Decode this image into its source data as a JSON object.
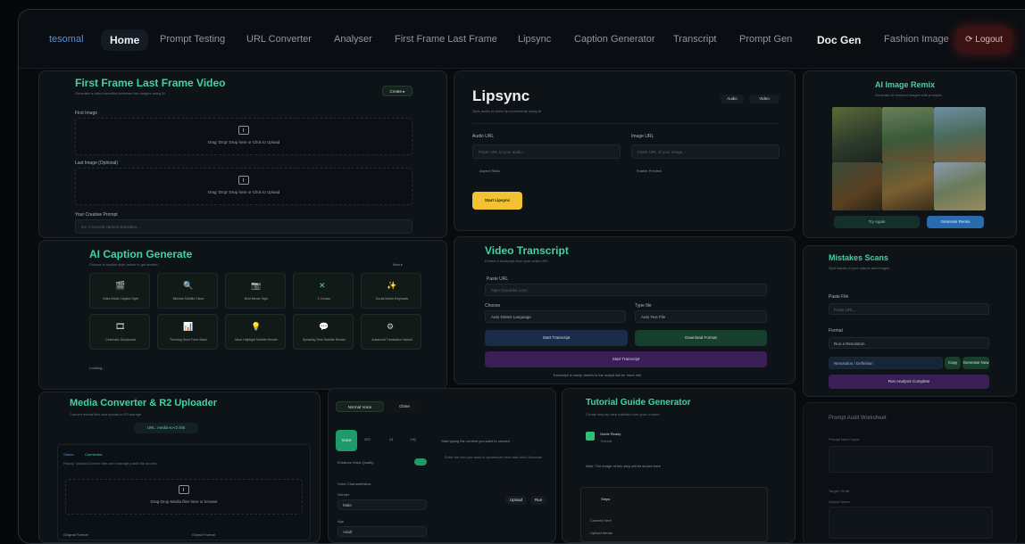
{
  "nav": {
    "brand": "tesomal",
    "items": [
      "Home",
      "Prompt Testing",
      "URL Converter",
      "Analyser",
      "First Frame Last Frame",
      "Lipsync",
      "Caption Generator",
      "Transcript",
      "Prompt Gen",
      "Doc Gen",
      "Fashion Image"
    ],
    "logout": "⟳ Logout"
  },
  "flf": {
    "title": "First Frame Last Frame Video",
    "desc": "Generate a video transition between two images using AI",
    "button": "Create ▸",
    "first_label": "First Image",
    "drop_text": "Drag 'Drop' Drop here or Click to Upload",
    "last_label": "Last Image (Optional)",
    "prompt_label": "Your Creative Prompt",
    "prompt_placeholder": "Ex: A smooth camera transition..."
  },
  "lipsync": {
    "title": "Lipsync",
    "desc": "Sync audio to video lip movements using AI",
    "tab1": "Audio",
    "tab2": "Video",
    "audio_label": "Audio URL",
    "audio_placeholder": "Paste URL to your audio...",
    "image_label": "Image URL",
    "image_placeholder": "Paste URL of your image...",
    "opt1": "Aspect Ratio",
    "opt2": "Enable Preview",
    "button": "Start Lipsync"
  },
  "aiimage": {
    "title": "AI Image Remix",
    "desc": "Generate AI remixed images with prompts",
    "btn1": "Try Again",
    "btn2": "Generate Remix"
  },
  "caption": {
    "title": "AI Caption Generate",
    "desc": "Choose a caption style below to get started",
    "badge": "New ▸",
    "tiles": [
      {
        "icon": "🎬",
        "label": "Video Mode Caption Style"
      },
      {
        "icon": "🔍",
        "label": "Minimal Subtitle Clean"
      },
      {
        "icon": "📷",
        "label": "Bold Meme Style"
      },
      {
        "icon": "✕",
        "label": "X Creator"
      },
      {
        "icon": "✨",
        "label": "Social Media Emphasis"
      },
      {
        "icon": "🎞",
        "label": "Cinematic Storyboard"
      },
      {
        "icon": "📊",
        "label": "Trending Short Form Stack"
      },
      {
        "icon": "💡",
        "label": "Neon Highlight Subtitle Render"
      },
      {
        "icon": "💬",
        "label": "Speaking Tone Subtitle Render"
      },
      {
        "icon": "⚙",
        "label": "Advanced Translation Variant"
      }
    ],
    "footer": "Loading..."
  },
  "transcript": {
    "title": "Video Transcript",
    "desc": "Extract a transcript from your video URL",
    "url_label": "Paste URL",
    "url_placeholder": "https://youtube.com/...",
    "choose_label": "Choose",
    "choose_value": "Auto Detect Language",
    "type_label": "Type file",
    "type_value": "Auto Text File",
    "btn_blue": "Start Transcript",
    "btn_green": "Download Format",
    "btn_purple": "Start Transcript",
    "footer": "Transcript is ready, switch to the output tab for more info"
  },
  "stock": {
    "title": "Mistakes Scans",
    "desc": "Spot issues in your videos and images",
    "paste_label": "Paste File",
    "paste_placeholder": "Paste URL...",
    "format_label": "Format",
    "format_value": "Run a Resolution",
    "field_label": "Resolution / Definition",
    "btn_small": "Copy",
    "btn_teal": "Generate Now",
    "btn_purple": "Run Analysis Complete"
  },
  "media": {
    "title": "Media Converter & R2 Uploader",
    "desc": "Convert media files and upload to R2 storage",
    "chip": "URL: media-to-r2.link",
    "status_label": "Status:",
    "status_value": "Connected",
    "status_desc": "Ready: Upload/Convert files and manage public file access",
    "drop_text": "Drag-Drop Media files here or browse",
    "col1": "Original Format",
    "col2": "Output Format"
  },
  "tts": {
    "tab1": "Normal Voice",
    "tab2": "Clone",
    "vals": [
      "Voice",
      "320",
      "24",
      "HQ"
    ],
    "toggle_label": "Enhance Voice Quality",
    "section_label": "Voice Characteristics",
    "opt1": "Gender",
    "val1": "Male",
    "opt2": "Age",
    "val2": "Adult",
    "side_text": "Start typing the content you want to convert",
    "side_line2": "Enter the text you want to synthesize here and click Generate",
    "btn1": "Upload",
    "btn2": "Run"
  },
  "tutorial": {
    "title": "Tutorial Guide Generator",
    "desc": "Create step-by-step tutorials from your content",
    "item_title": "Guide Ready",
    "item_sub": "Tutorial",
    "note": "Note: The image of this step will be shown here",
    "box_title": "Steps",
    "box_line": "Content Here",
    "box_value": "Upload Media"
  },
  "ghost": {
    "title": "Prompt Audit Worksheet",
    "label1": "Prompt Idea / Input",
    "label2": "Target / Draft",
    "label3": "Output Notes"
  }
}
